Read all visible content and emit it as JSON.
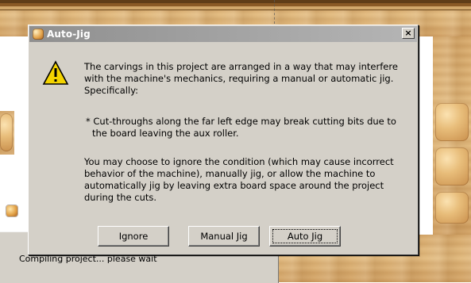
{
  "background": {
    "status_text": "Compiling project... please wait"
  },
  "dialog": {
    "title": "Auto-Jig",
    "close_label": "×",
    "warning_icon": "warning-icon",
    "message_1": "The carvings in this project are arranged in a way that may interfere with the machine's mechanics, requiring a manual or automatic jig.  Specifically:",
    "message_2": "* Cut-throughs along the far left edge may break cutting bits due to the board leaving the aux roller.",
    "message_3": "You may choose to ignore the condition (which may cause incorrect behavior of the machine), manually jig, or allow the machine to automatically jig by leaving extra board space around the project during the cuts.",
    "buttons": {
      "ignore": "Ignore",
      "manual": "Manual Jig",
      "auto": "Auto Jig"
    }
  },
  "colors": {
    "window_face": "#d4d0c8",
    "inactive_title_start": "#8f8f8f",
    "inactive_title_end": "#b5b5b5",
    "wood": "#d7aa6d",
    "warning_yellow": "#f4d400"
  }
}
